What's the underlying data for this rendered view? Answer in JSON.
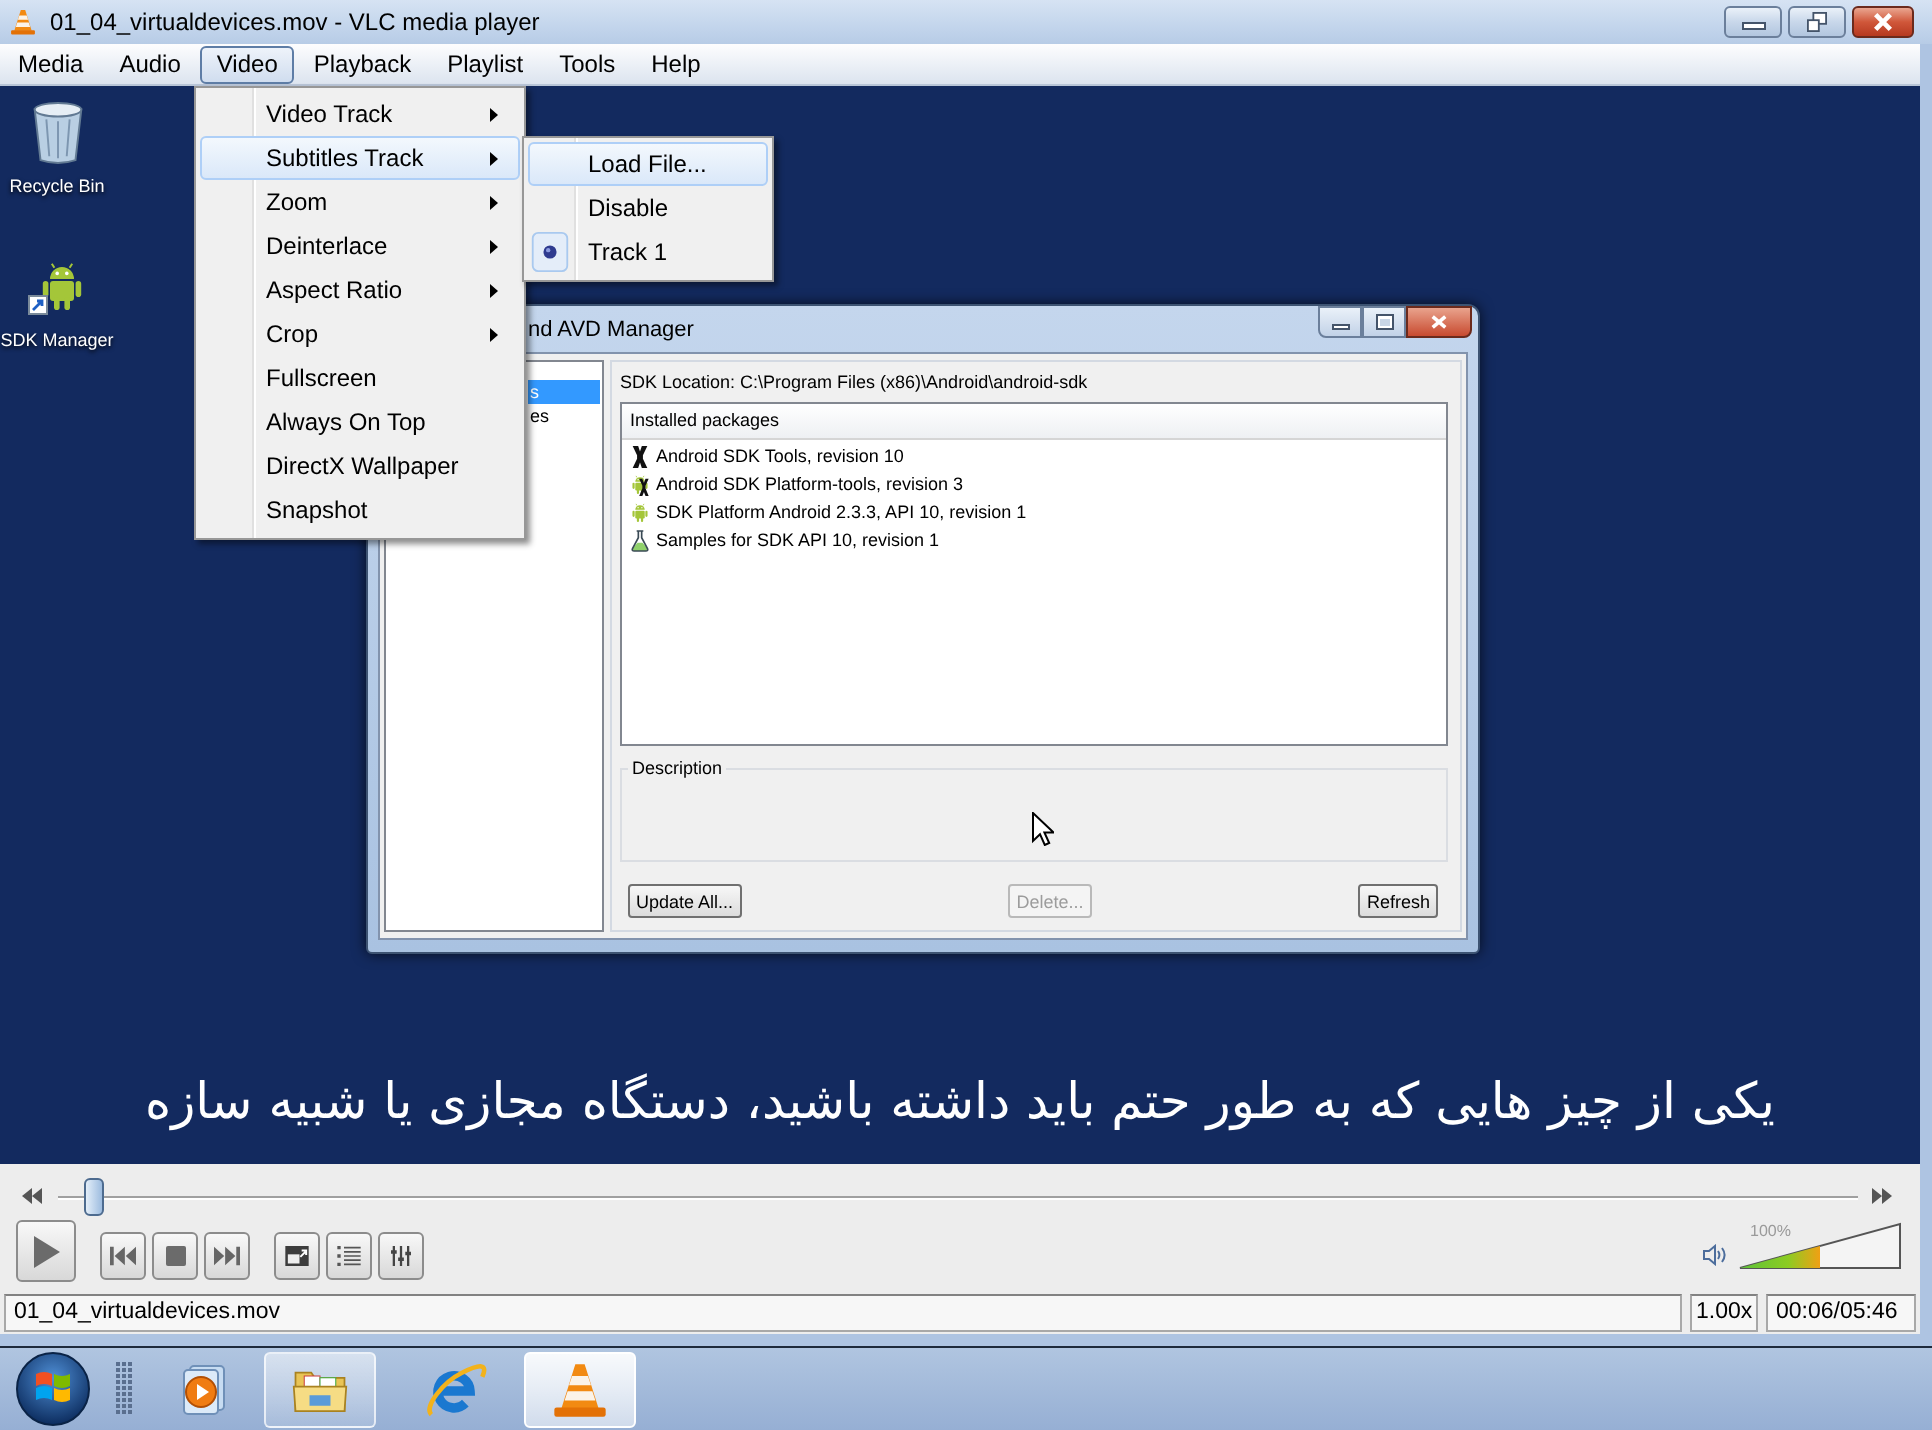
{
  "window": {
    "title": "01_04_virtualdevices.mov - VLC media player"
  },
  "menu_bar": [
    {
      "label": "Media",
      "selected": false
    },
    {
      "label": "Audio",
      "selected": false
    },
    {
      "label": "Video",
      "selected": true
    },
    {
      "label": "Playback",
      "selected": false
    },
    {
      "label": "Playlist",
      "selected": false
    },
    {
      "label": "Tools",
      "selected": false
    },
    {
      "label": "Help",
      "selected": false
    }
  ],
  "video_menu": [
    {
      "label": "Video Track",
      "submenu": true,
      "selected": false
    },
    {
      "label": "Subtitles Track",
      "submenu": true,
      "selected": true
    },
    {
      "label": "Zoom",
      "submenu": true,
      "selected": false
    },
    {
      "label": "Deinterlace",
      "submenu": true,
      "selected": false
    },
    {
      "label": "Aspect Ratio",
      "submenu": true,
      "selected": false
    },
    {
      "label": "Crop",
      "submenu": true,
      "selected": false
    },
    {
      "label": "Fullscreen",
      "submenu": false,
      "selected": false
    },
    {
      "label": "Always On Top",
      "submenu": false,
      "selected": false
    },
    {
      "label": "DirectX Wallpaper",
      "submenu": false,
      "selected": false
    },
    {
      "label": "Snapshot",
      "submenu": false,
      "selected": false
    }
  ],
  "subtitles_submenu": [
    {
      "label": "Load File...",
      "selected": true,
      "checked": false
    },
    {
      "label": "Disable",
      "selected": false,
      "checked": false
    },
    {
      "label": "Track 1",
      "selected": false,
      "checked": true
    }
  ],
  "video_frame": {
    "desktop_icons": [
      {
        "label": "Recycle Bin",
        "kind": "recycle-bin"
      },
      {
        "label": "SDK Manager",
        "kind": "sdk-shortcut"
      }
    ],
    "sdk_window": {
      "title": "nd AVD Manager",
      "sidebar": [
        {
          "label": "s",
          "selected": true
        },
        {
          "label": "es",
          "selected": false
        }
      ],
      "location": "SDK Location: C:\\Program Files (x86)\\Android\\android-sdk",
      "table_header": "Installed packages",
      "packages": [
        {
          "label": "Android SDK Tools, revision 10",
          "kind": "tools"
        },
        {
          "label": "Android SDK Platform-tools, revision 3",
          "kind": "platform-tools"
        },
        {
          "label": "SDK Platform Android 2.3.3, API 10, revision 1",
          "kind": "platform"
        },
        {
          "label": "Samples for SDK API 10, revision 1",
          "kind": "samples"
        }
      ],
      "description_label": "Description",
      "buttons": [
        {
          "label": "Update All...",
          "disabled": false
        },
        {
          "label": "Delete...",
          "disabled": true
        },
        {
          "label": "Refresh",
          "disabled": false
        }
      ]
    },
    "subtitle": "یکی از چیز هایی که به طور حتم باید داشته باشید، دستگاه مجازی یا شبیه سازه"
  },
  "seek_bar": {
    "level": 0.02
  },
  "volume": {
    "level": 0.5,
    "reading": "100%"
  },
  "status_bar": {
    "file": "01_04_virtualdevices.mov",
    "speed": "1.00x",
    "time": "00:06/05:46"
  },
  "taskbar": [
    {
      "kind": "media-player",
      "running": false,
      "active": false
    },
    {
      "kind": "folder",
      "running": true,
      "active": false
    },
    {
      "kind": "browser",
      "running": false,
      "active": false
    },
    {
      "kind": "vlc",
      "running": true,
      "active": true
    }
  ]
}
